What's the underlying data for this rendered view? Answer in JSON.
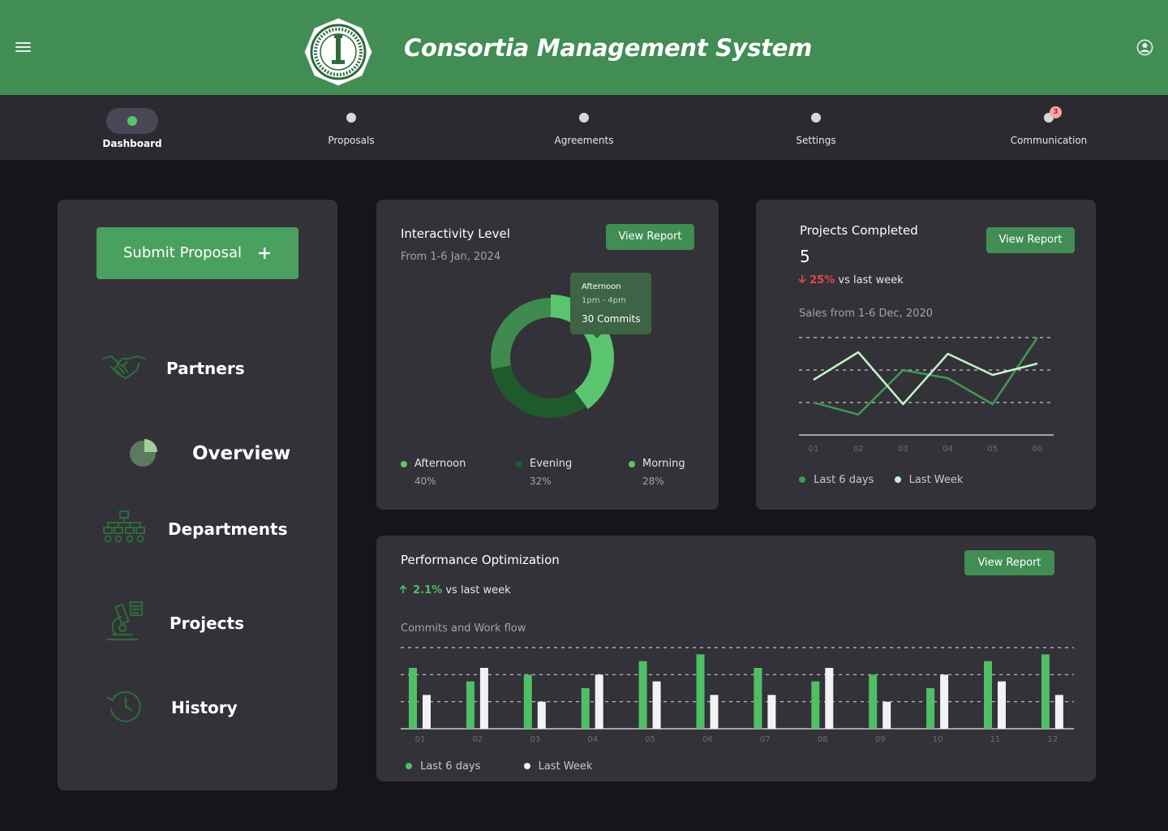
{
  "header": {
    "title": "Consortia Management System",
    "menu_icon": "hamburger-menu-icon",
    "user_icon": "user-account-icon",
    "logo": "university-seal-logo",
    "color": "#418d54"
  },
  "nav": {
    "items": [
      {
        "label": "Dashboard",
        "active": true
      },
      {
        "label": "Proposals"
      },
      {
        "label": "Agreements"
      },
      {
        "label": "Settings"
      },
      {
        "label": "Communication",
        "badge": "3"
      }
    ]
  },
  "sidebar": {
    "submit_label": "Submit Proposal",
    "items": [
      {
        "label": "Partners",
        "icon": "handshake-icon"
      },
      {
        "label": "Overview",
        "icon": "pie-chart-icon"
      },
      {
        "label": "Departments",
        "icon": "org-chart-icon"
      },
      {
        "label": "Projects",
        "icon": "microscope-icon"
      },
      {
        "label": "History",
        "icon": "history-clock-icon"
      }
    ]
  },
  "interactivity": {
    "title": "Interactivity Level",
    "subtitle": "From 1-6 Jan, 2024",
    "button": "View Report",
    "tooltip": {
      "title": "Afternoon",
      "time": "1pm - 4pm",
      "value": "30 Commits"
    },
    "legend": [
      {
        "name": "Afternoon",
        "value": "40%",
        "color": "#5bc46f"
      },
      {
        "name": "Evening",
        "value": "32%",
        "color": "#1f5a2c"
      },
      {
        "name": "Morning",
        "value": "28%",
        "color": "#3e8a4f"
      }
    ]
  },
  "projects": {
    "title": "Projects Completed",
    "count": "5",
    "change": "25%",
    "change_text": "vs last week",
    "chart_title": "Sales from 1-6 Dec, 2020",
    "button": "View Report"
  },
  "performance": {
    "title": "Performance Optimization",
    "change": "2.1%",
    "change_text": "vs last week",
    "chart_title": "Commits and Work flow",
    "button": "View Report"
  },
  "chart_data": [
    {
      "type": "pie",
      "title": "Interactivity Level",
      "categories": [
        "Afternoon",
        "Evening",
        "Morning"
      ],
      "values": [
        40,
        32,
        28
      ],
      "colors": [
        "#5bc46f",
        "#1f5a2c",
        "#3e8a4f"
      ]
    },
    {
      "type": "line",
      "title": "Sales from 1-6 Dec, 2020",
      "categories": [
        "01",
        "02",
        "03",
        "04",
        "05",
        "06"
      ],
      "ylim": [
        0,
        3
      ],
      "series": [
        {
          "name": "Last 6 days",
          "color": "#3e9a54",
          "values": [
            1.0,
            0.63,
            2.0,
            1.75,
            0.95,
            3.0
          ]
        },
        {
          "name": "Last Week",
          "color": "#c6f2c9",
          "values": [
            1.7,
            2.55,
            0.95,
            2.5,
            1.85,
            2.2
          ]
        }
      ],
      "grid": true
    },
    {
      "type": "bar",
      "title": "Commits and Work flow",
      "categories": [
        "01",
        "02",
        "03",
        "04",
        "05",
        "06",
        "07",
        "08",
        "09",
        "10",
        "11",
        "12"
      ],
      "ylim": [
        0,
        3
      ],
      "series": [
        {
          "name": "Last 6 days",
          "color": "#4fbf66",
          "values": [
            2.25,
            1.75,
            2.0,
            1.5,
            2.5,
            2.75,
            2.25,
            1.75,
            2.0,
            1.5,
            2.5,
            2.75
          ]
        },
        {
          "name": "Last Week",
          "color": "#f2f2f4",
          "values": [
            1.25,
            2.25,
            1.0,
            2.0,
            1.75,
            1.25,
            1.25,
            2.25,
            1.0,
            2.0,
            1.75,
            1.25
          ]
        }
      ],
      "grid": true
    }
  ]
}
